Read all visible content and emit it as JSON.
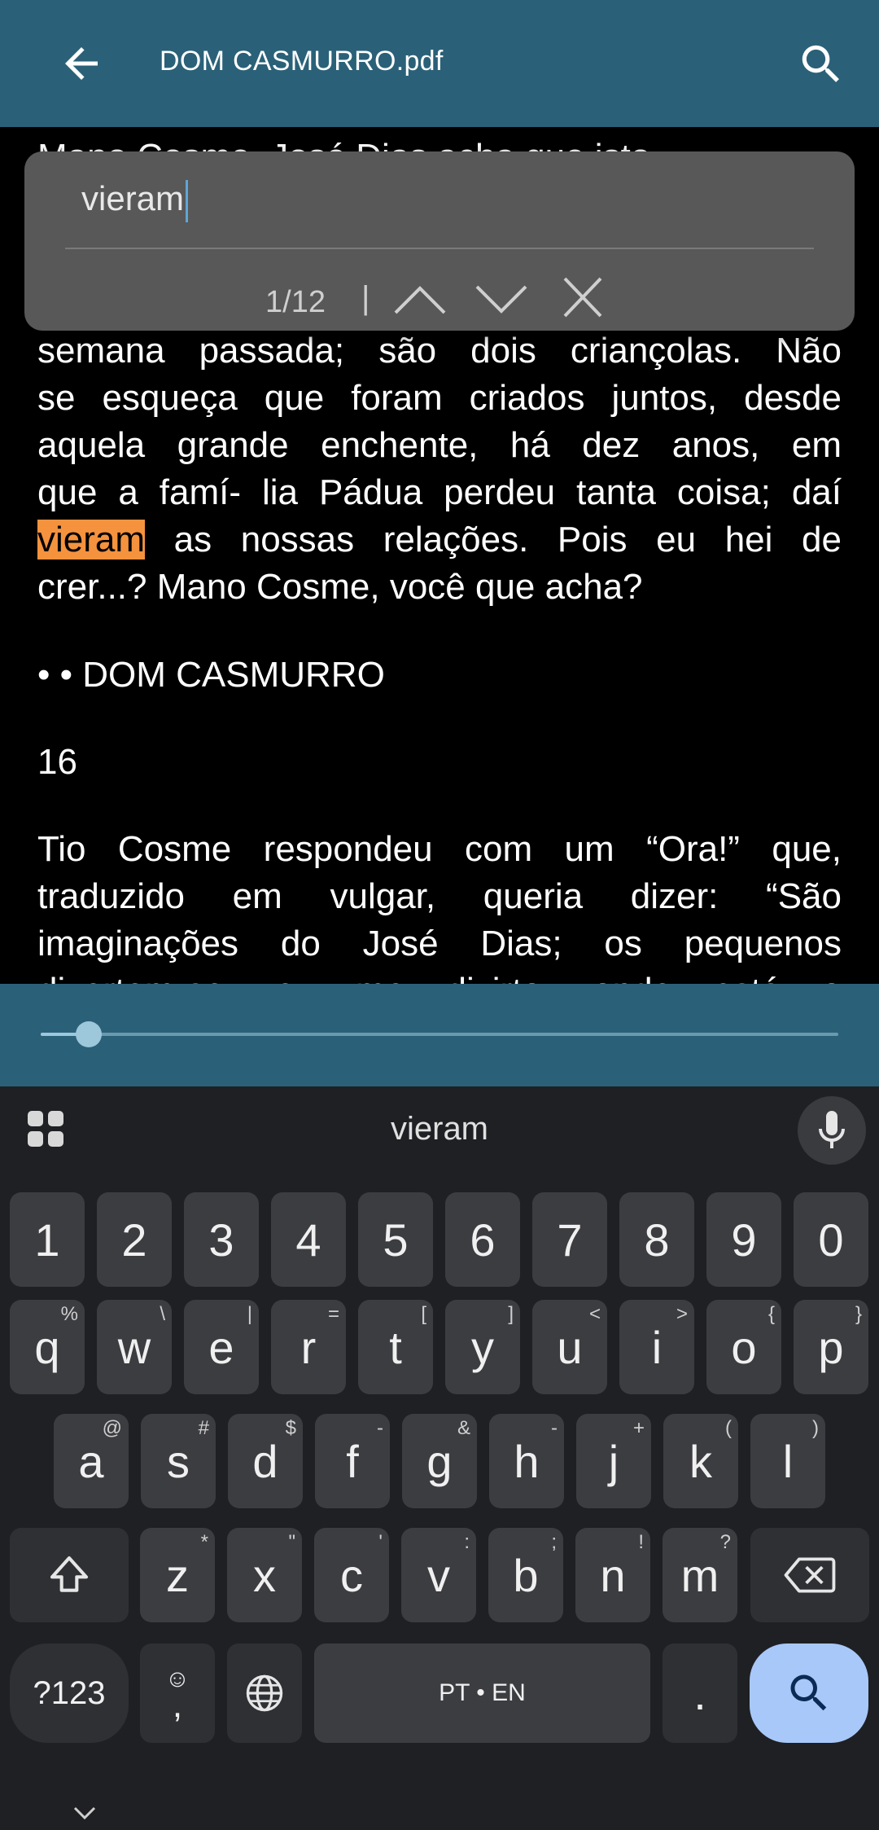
{
  "app": {
    "title": "DOM CASMURRO.pdf",
    "back_icon": "arrow-back-icon",
    "search_icon": "search-icon",
    "bar_color": "#2a6178"
  },
  "reader": {
    "top_partial": "Mano Cosme, José Dias acha que isto",
    "main_lines": [
      "semana passada; são dois criançolas. Não",
      "se esqueça que foram criados juntos, desde",
      "aquela grande enchente, há dez anos, em",
      "que a famí- lia Pádua perdeu tanta coisa; daí"
    ],
    "highlight_word": "vieram",
    "line5_rest": " as nossas relações. Pois eu hei de",
    "line6": "crer...? Mano Cosme, você que acha?",
    "running_header": "• • DOM CASMURRO",
    "page_number": "16",
    "next_lines": [
      "Tio Cosme respondeu com um “Ora!” que,",
      "traduzido em vulgar, queria dizer: “São",
      "imaginações do José Dias; os pequenos",
      "divertem-se, eu me divirto; onde está o"
    ],
    "highlight_color": "#f5923e"
  },
  "search": {
    "query": "vieram",
    "match_count": "1/12",
    "separator": "|",
    "prev_icon": "chevron-up-icon",
    "next_icon": "chevron-down-icon",
    "close_icon": "close-icon"
  },
  "slider": {
    "progress": 0.06
  },
  "keyboard": {
    "suggestion": "vieram",
    "numbers": [
      "1",
      "2",
      "3",
      "4",
      "5",
      "6",
      "7",
      "8",
      "9",
      "0"
    ],
    "row1": [
      {
        "k": "q",
        "s": "%"
      },
      {
        "k": "w",
        "s": "\\"
      },
      {
        "k": "e",
        "s": "|"
      },
      {
        "k": "r",
        "s": "="
      },
      {
        "k": "t",
        "s": "["
      },
      {
        "k": "y",
        "s": "]"
      },
      {
        "k": "u",
        "s": "<"
      },
      {
        "k": "i",
        "s": ">"
      },
      {
        "k": "o",
        "s": "{"
      },
      {
        "k": "p",
        "s": "}"
      }
    ],
    "row2": [
      {
        "k": "a",
        "s": "@"
      },
      {
        "k": "s",
        "s": "#"
      },
      {
        "k": "d",
        "s": "$"
      },
      {
        "k": "f",
        "s": "-"
      },
      {
        "k": "g",
        "s": "&"
      },
      {
        "k": "h",
        "s": "-"
      },
      {
        "k": "j",
        "s": "+"
      },
      {
        "k": "k",
        "s": "("
      },
      {
        "k": "l",
        "s": ")"
      }
    ],
    "row3": [
      {
        "k": "z",
        "s": "*"
      },
      {
        "k": "x",
        "s": "\""
      },
      {
        "k": "c",
        "s": "'"
      },
      {
        "k": "v",
        "s": ":"
      },
      {
        "k": "b",
        "s": ";"
      },
      {
        "k": "n",
        "s": "!"
      },
      {
        "k": "m",
        "s": "?"
      }
    ],
    "symbols_label": "?123",
    "emoji_label": "☺",
    "comma_label": ",",
    "space_label": "PT • EN",
    "period_label": ".",
    "shift_icon": "shift-icon",
    "backspace_icon": "backspace-icon",
    "globe_icon": "globe-icon",
    "search_key_icon": "search-icon",
    "mic_icon": "microphone-icon",
    "grid_icon": "apps-grid-icon",
    "hide_icon": "chevron-down-icon",
    "accent_color": "#a8c8fa"
  }
}
